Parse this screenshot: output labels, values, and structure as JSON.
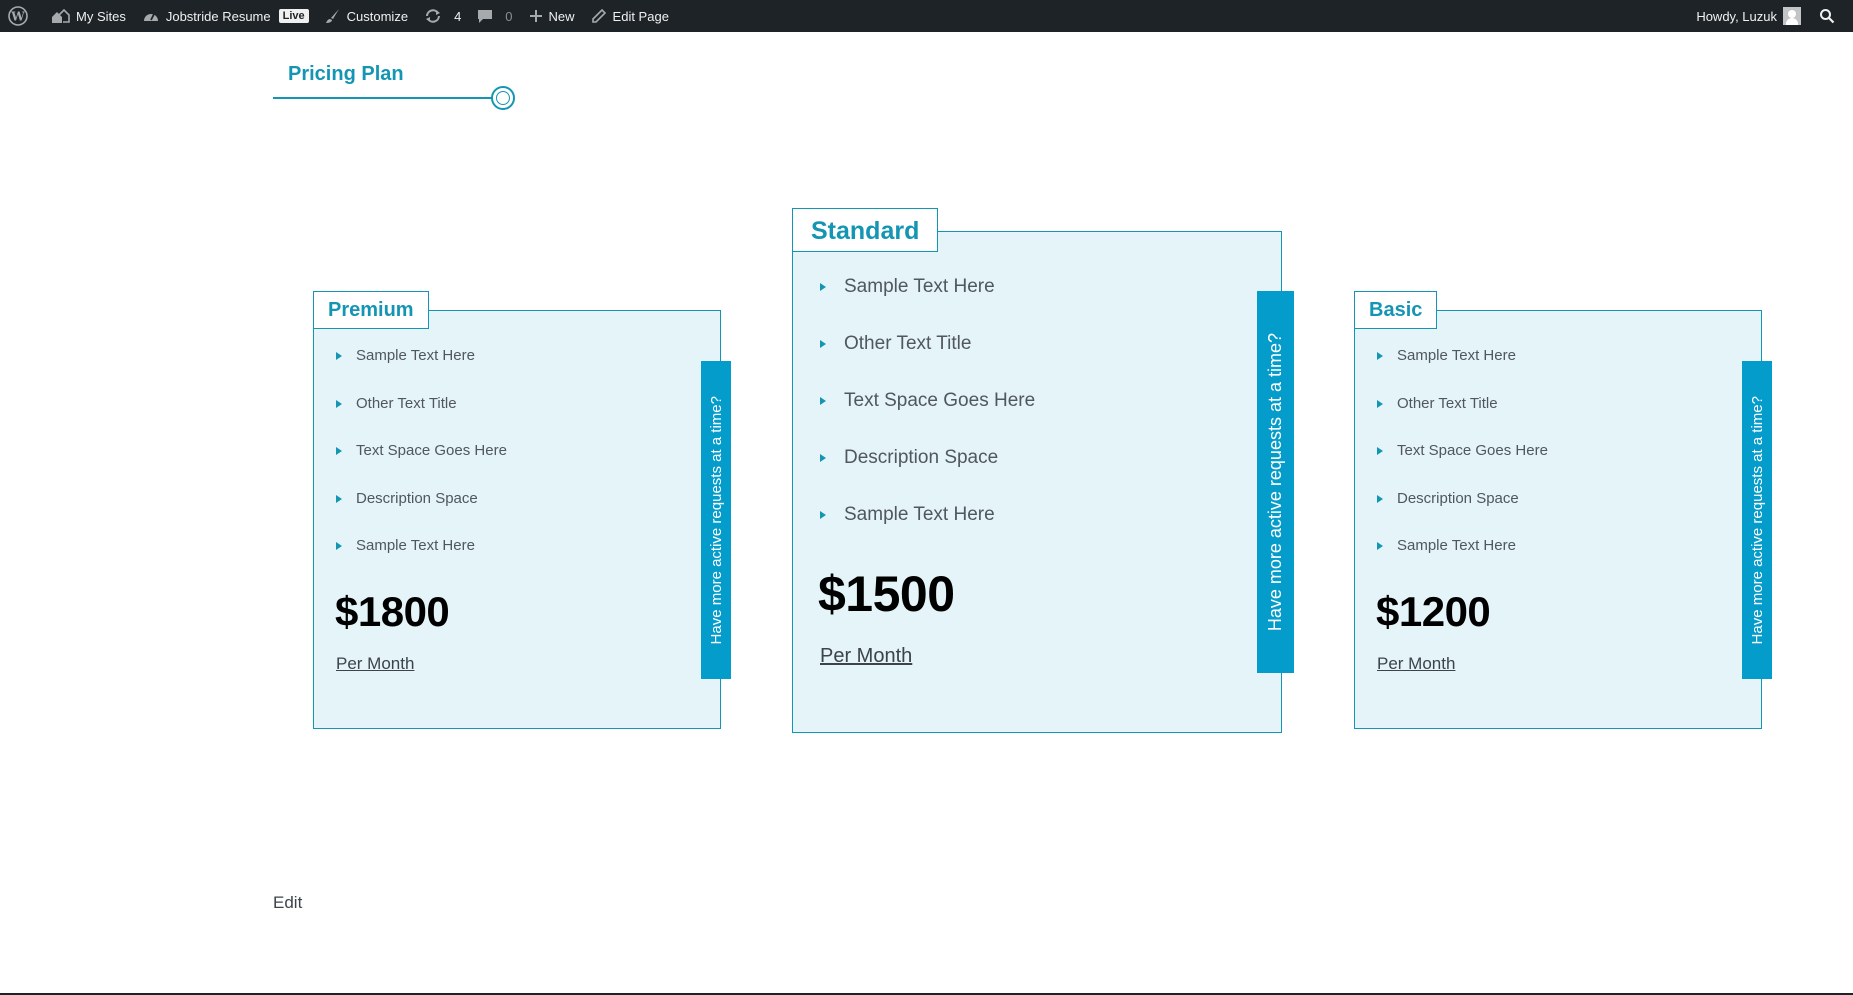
{
  "adminbar": {
    "my_sites": "My Sites",
    "site_name": "Jobstride Resume",
    "live_badge": "Live",
    "customize": "Customize",
    "updates_count": "4",
    "comments_count": "0",
    "new": "New",
    "edit_page": "Edit Page",
    "howdy": "Howdy, Luzuk"
  },
  "section": {
    "title": "Pricing Plan"
  },
  "ribbon_text": "Have more active requests at a time?",
  "plans": [
    {
      "name": "Premium",
      "features": [
        "Sample Text Here",
        "Other Text Title",
        "Text Space Goes Here",
        "Description Space",
        "Sample Text Here"
      ],
      "price": "$1800",
      "period": "Per Month"
    },
    {
      "name": "Standard",
      "features": [
        "Sample Text Here",
        "Other Text Title",
        "Text Space Goes Here",
        "Description Space",
        "Sample Text Here"
      ],
      "price": "$1500",
      "period": "Per Month"
    },
    {
      "name": "Basic",
      "features": [
        "Sample Text Here",
        "Other Text Title",
        "Text Space Goes Here",
        "Description Space",
        "Sample Text Here"
      ],
      "price": "$1200",
      "period": "Per Month"
    }
  ],
  "edit_link": "Edit",
  "colors": {
    "accent": "#1595b4",
    "ribbon": "#049ccb",
    "card_bg": "#e4f4f8",
    "adminbar": "#1d2327"
  }
}
